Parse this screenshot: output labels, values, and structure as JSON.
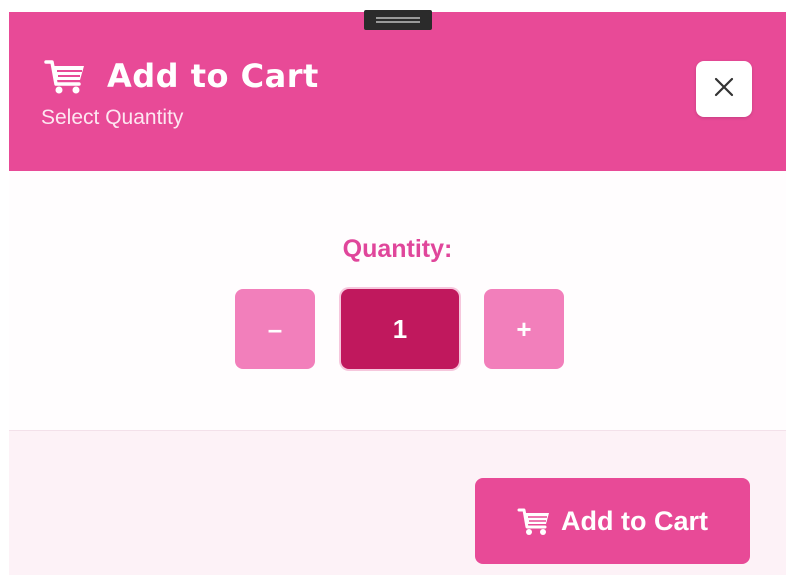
{
  "header": {
    "title": "Add to Cart",
    "subtitle": "Select Quantity",
    "icon": "shopping-cart-icon",
    "background": "#e84a97",
    "close_icon": "close-icon"
  },
  "quantity": {
    "label": "Quantity:",
    "decrement_label": "–",
    "increment_label": "+",
    "value": "1"
  },
  "footer": {
    "add_button_label": "Add to Cart",
    "add_button_icon": "shopping-cart-icon"
  },
  "colors": {
    "primary": "#e84a97",
    "stepper": "#f27fbb",
    "value_bg": "#c0185d",
    "footer_bg": "#fdf2f7"
  }
}
